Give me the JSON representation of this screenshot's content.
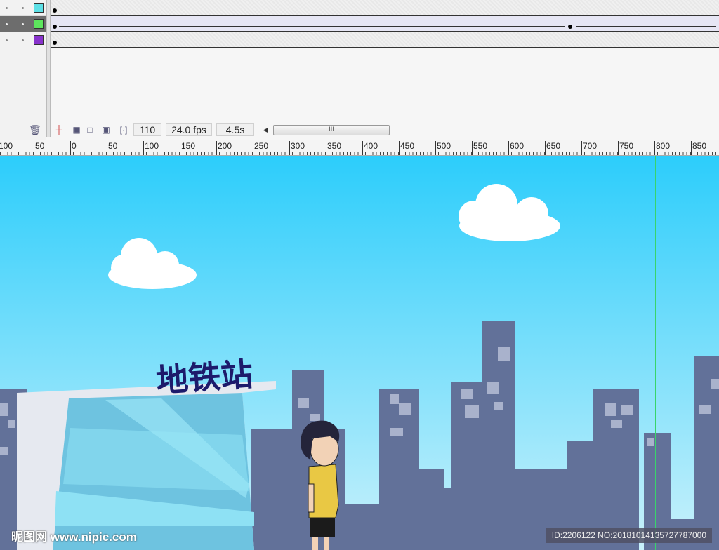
{
  "timeline": {
    "layers": [
      {
        "color": "#5de0e6",
        "selected": false
      },
      {
        "color": "#5de65d",
        "selected": true
      },
      {
        "color": "#8833cc",
        "selected": false
      }
    ],
    "current_frame": "110",
    "frame_rate": "24.0 fps",
    "elapsed_time": "4.5s"
  },
  "ruler": {
    "labels": [
      "100",
      "50",
      "0",
      "50",
      "100",
      "150",
      "200",
      "250",
      "300",
      "350",
      "400",
      "450",
      "500",
      "550",
      "600",
      "650",
      "700",
      "750",
      "800",
      "850"
    ]
  },
  "stage": {
    "sign_text": "地铁站"
  },
  "watermark": {
    "logo": "昵图网",
    "site": "www.nipic.com",
    "id": "ID:2206122 NO:20181014135727787000"
  }
}
